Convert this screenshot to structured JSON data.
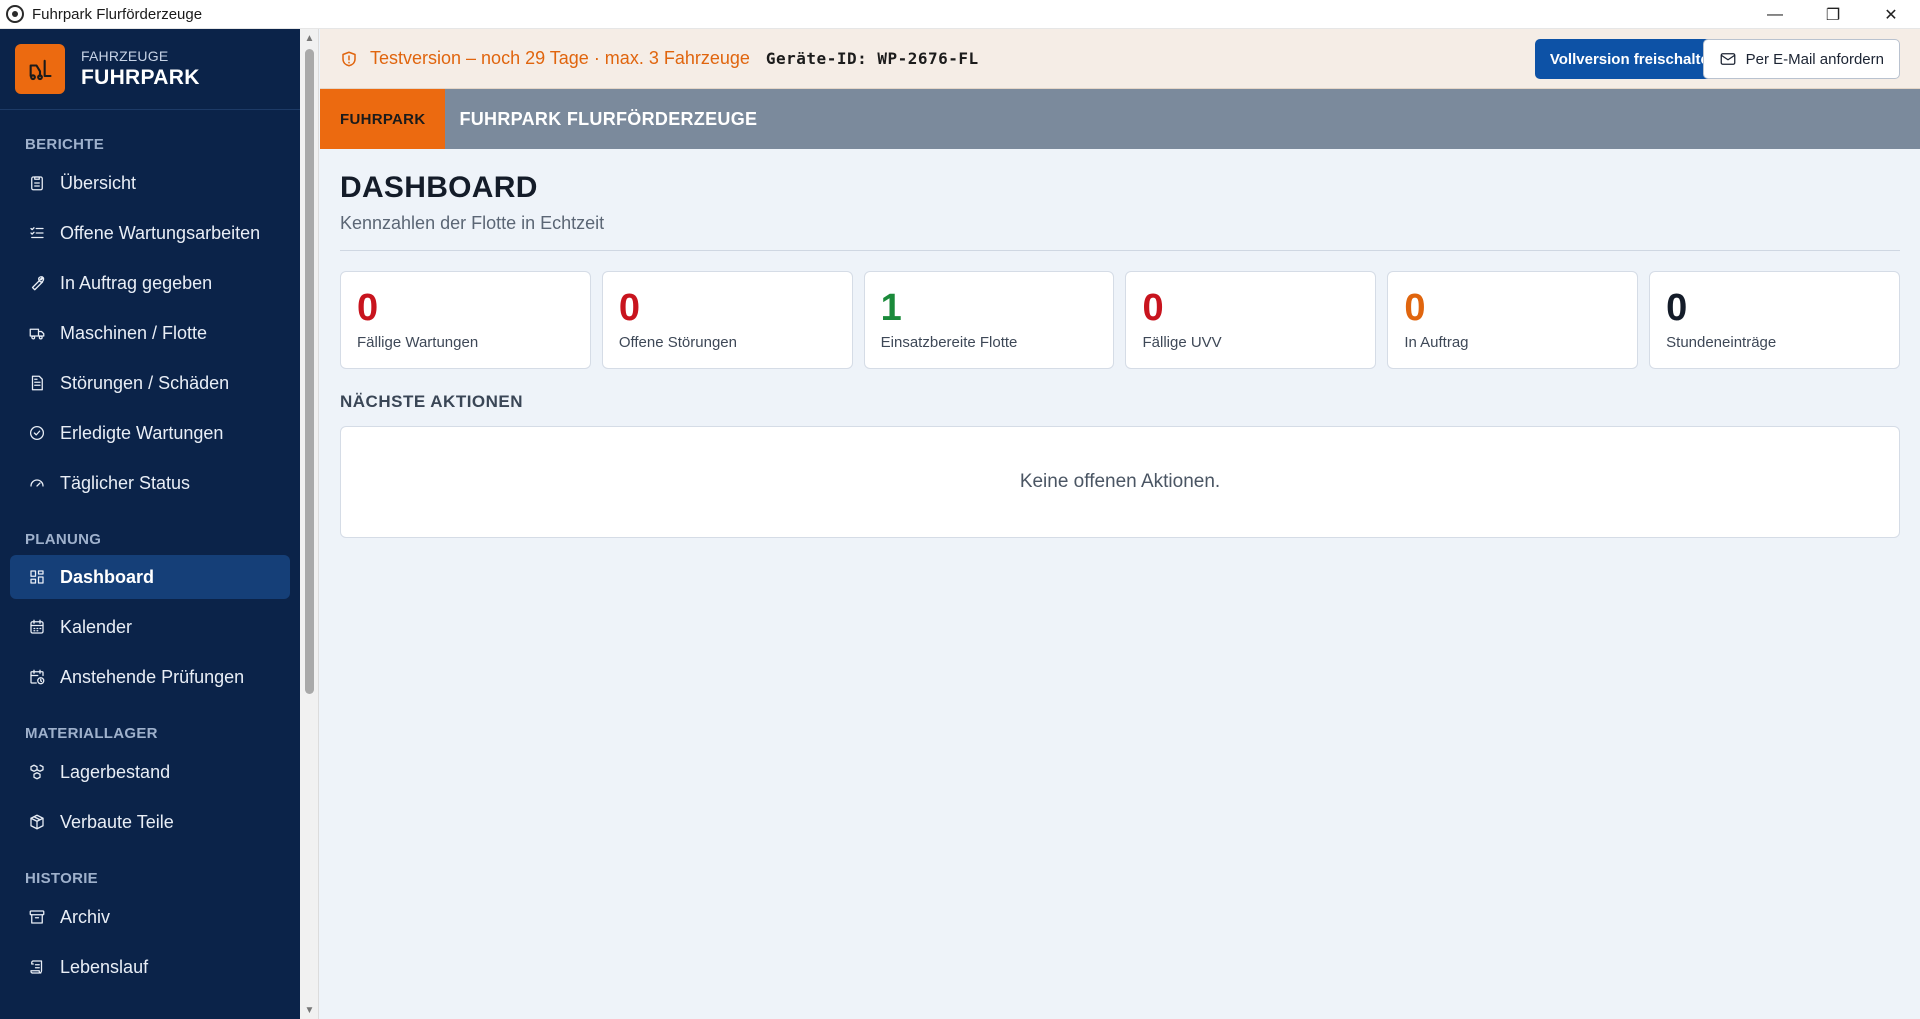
{
  "window": {
    "title": "Fuhrpark Flurförderzeuge",
    "controls": {
      "minimize": "—",
      "restore": "❐",
      "close": "✕"
    }
  },
  "sidebar": {
    "brand_small": "FAHRZEUGE",
    "brand_big": "FUHRPARK",
    "sections": {
      "berichte": "BERICHTE",
      "planung": "PLANUNG",
      "materiallager": "MATERIALLAGER",
      "historie": "HISTORIE"
    },
    "items": [
      {
        "label": "Übersicht",
        "icon": "clipboard-icon"
      },
      {
        "label": "Offene Wartungsarbeiten",
        "icon": "list-check-icon"
      },
      {
        "label": "In Auftrag gegeben",
        "icon": "wrench-icon"
      },
      {
        "label": "Maschinen / Flotte",
        "icon": "truck-icon"
      },
      {
        "label": "Störungen / Schäden",
        "icon": "document-icon"
      },
      {
        "label": "Erledigte Wartungen",
        "icon": "check-circle-icon"
      },
      {
        "label": "Täglicher Status",
        "icon": "gauge-icon"
      },
      {
        "label": "Dashboard",
        "icon": "grid-icon",
        "active": true
      },
      {
        "label": "Kalender",
        "icon": "calendar-icon"
      },
      {
        "label": "Anstehende Prüfungen",
        "icon": "calendar-clock-icon"
      },
      {
        "label": "Lagerbestand",
        "icon": "boxes-icon"
      },
      {
        "label": "Verbaute Teile",
        "icon": "package-icon"
      },
      {
        "label": "Archiv",
        "icon": "archive-icon"
      },
      {
        "label": "Lebenslauf",
        "icon": "scroll-icon"
      }
    ]
  },
  "trial": {
    "text": "Testversion – noch 29 Tage · max. 3 Fahrzeuge",
    "device_id": "Geräte-ID: WP-2676-FL",
    "unlock_label": "Vollversion freischalten",
    "email_label": "Per E-Mail anfordern"
  },
  "breadcrumb": {
    "tag": "FUHRPARK",
    "title": "FUHRPARK FLURFÖRDERZEUGE"
  },
  "page": {
    "title": "DASHBOARD",
    "subtitle": "Kennzahlen der Flotte in Echtzeit"
  },
  "kpis": [
    {
      "value": "0",
      "label": "Fällige Wartungen",
      "color": "#c8141e"
    },
    {
      "value": "0",
      "label": "Offene Störungen",
      "color": "#c8141e"
    },
    {
      "value": "1",
      "label": "Einsatzbereite Flotte",
      "color": "#1a8a3a"
    },
    {
      "value": "0",
      "label": "Fällige UVV",
      "color": "#c8141e"
    },
    {
      "value": "0",
      "label": "In Auftrag",
      "color": "#e0650e"
    },
    {
      "value": "0",
      "label": "Stundeneinträge",
      "color": "#141c29"
    }
  ],
  "actions": {
    "heading": "NÄCHSTE AKTIONEN",
    "empty": "Keine offenen Aktionen."
  },
  "colors": {
    "sidebar_bg": "#0b2349",
    "accent_orange": "#ec6a10",
    "primary_blue": "#0d52a6"
  }
}
